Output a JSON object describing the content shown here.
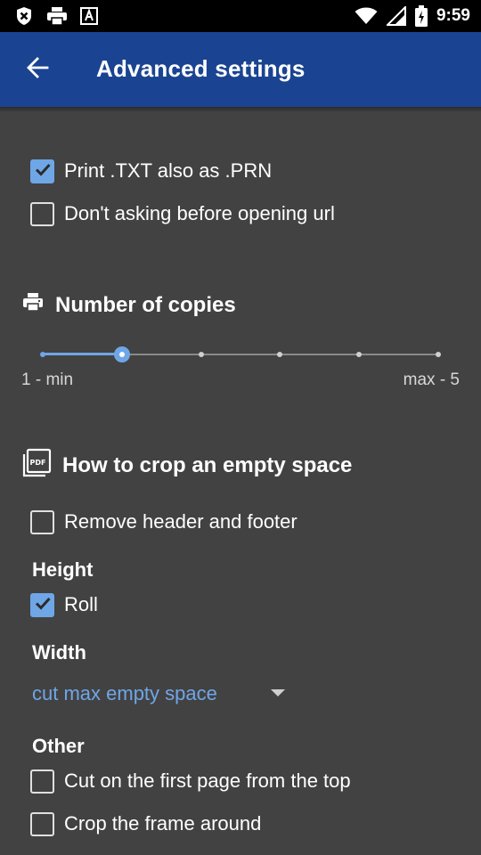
{
  "status_bar": {
    "time": "9:59",
    "left_icons": [
      "app-notification-icon",
      "print-notification-icon",
      "font-notification-icon"
    ],
    "right_icons": [
      "wifi-icon",
      "signal-icon",
      "battery-charging-icon"
    ]
  },
  "app_bar": {
    "title": "Advanced settings",
    "background_color": "#1a4491"
  },
  "general": {
    "print_txt_as_prn": {
      "label": "Print .TXT also as .PRN",
      "checked": true
    },
    "dont_ask_open_url": {
      "label": "Don't asking before opening url",
      "checked": false
    }
  },
  "copies": {
    "title": "Number of copies",
    "icon": "printer-icon",
    "min_label": "1 - min",
    "max_label": "max - 5",
    "min": 0,
    "max": 5,
    "value": 1
  },
  "crop": {
    "title": "How to crop an empty space",
    "icon": "pdf-icon",
    "remove_header_footer": {
      "label": "Remove header and footer",
      "checked": false
    },
    "height_label": "Height",
    "roll": {
      "label": "Roll",
      "checked": true
    },
    "width_label": "Width",
    "width_value": "cut max empty space",
    "other_label": "Other",
    "cut_first_page": {
      "label": "Cut on the first page from the top",
      "checked": false
    },
    "crop_frame": {
      "label": "Crop the frame around",
      "checked": false
    }
  },
  "colors": {
    "accent": "#6fa6e6",
    "background": "#424242"
  }
}
